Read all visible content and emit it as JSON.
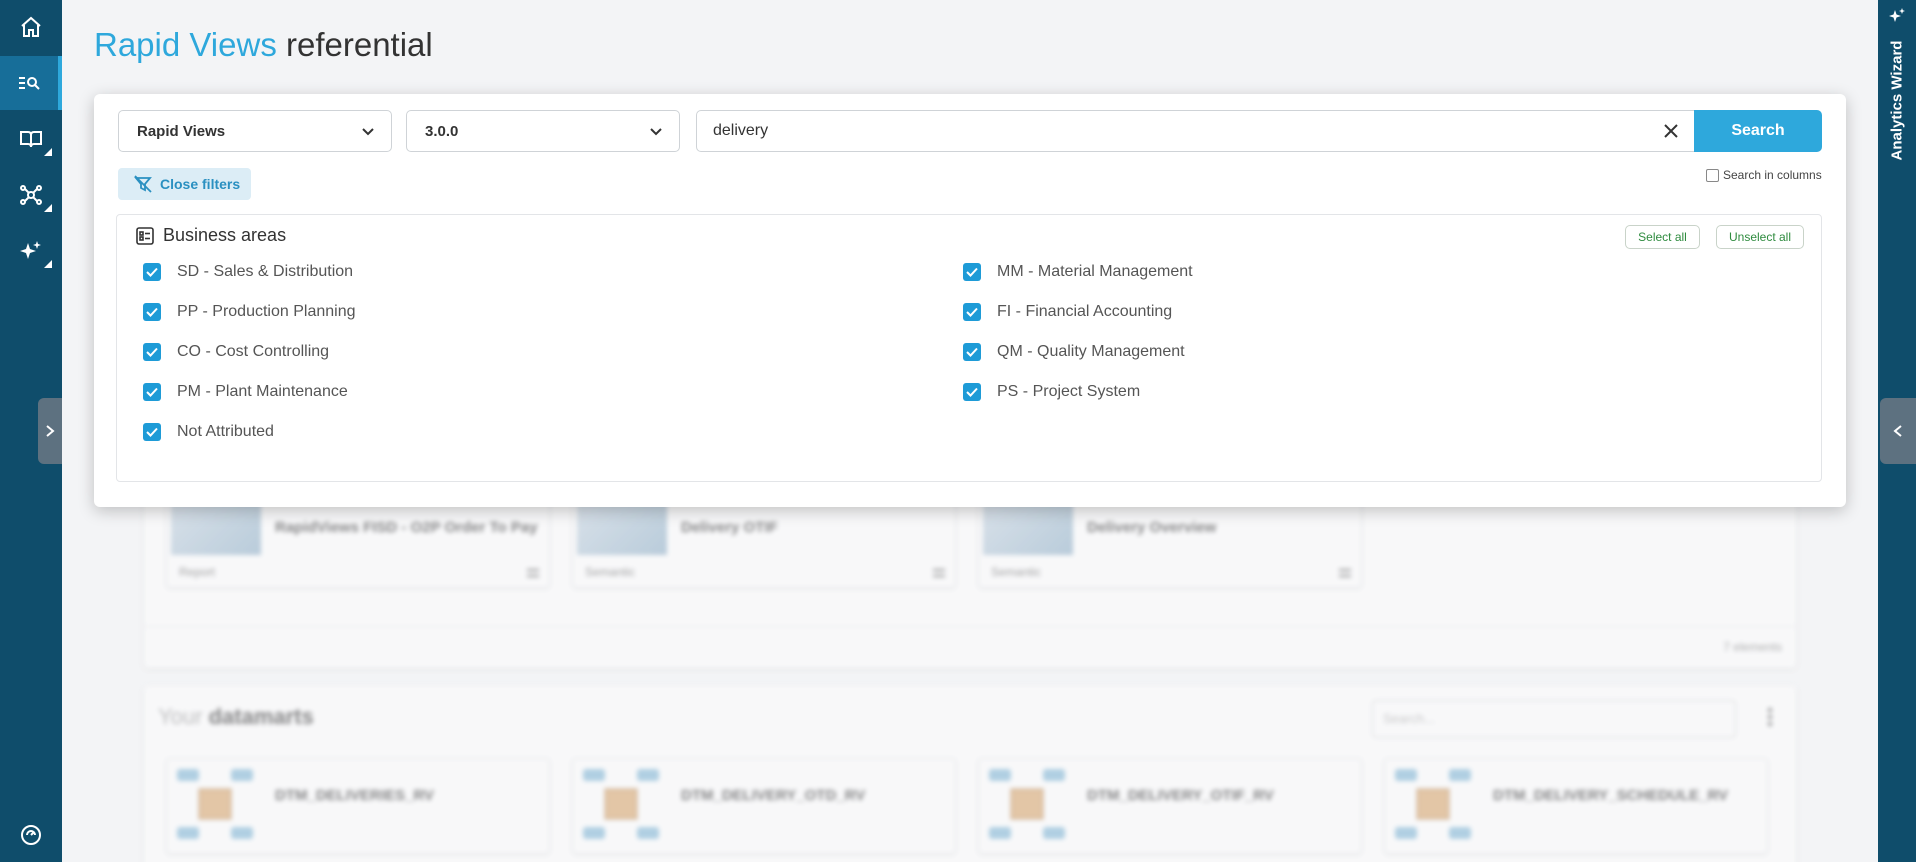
{
  "page": {
    "title_accent": "Rapid Views",
    "title_rest": " referential"
  },
  "nav": {
    "items": [
      "home-icon",
      "search-list-icon",
      "book-icon",
      "network-icon",
      "sparkle-icon"
    ],
    "bottom": "support-icon",
    "active": "search-list-icon"
  },
  "right_rail": {
    "label": "Analytics Wizard"
  },
  "search": {
    "source_select": "Rapid Views",
    "version_select": "3.0.0",
    "query": "delivery",
    "button_label": "Search",
    "close_filters_label": "Close filters",
    "search_in_columns_label": "Search in columns",
    "search_in_columns_checked": false
  },
  "business_areas": {
    "title": "Business areas",
    "select_all_label": "Select all",
    "unselect_all_label": "Unselect all",
    "left": [
      {
        "label": "SD - Sales & Distribution",
        "checked": true
      },
      {
        "label": "PP - Production Planning",
        "checked": true
      },
      {
        "label": "CO - Cost Controlling",
        "checked": true
      },
      {
        "label": "PM - Plant Maintenance",
        "checked": true
      },
      {
        "label": "Not Attributed",
        "checked": true
      }
    ],
    "right": [
      {
        "label": "MM - Material Management",
        "checked": true
      },
      {
        "label": "FI - Financial Accounting",
        "checked": true
      },
      {
        "label": "QM - Quality Management",
        "checked": true
      },
      {
        "label": "PS - Project System",
        "checked": true
      }
    ]
  },
  "background": {
    "report_cards": [
      {
        "title": "RapidViews FISD - O2P Order To Pay",
        "type": "Report"
      },
      {
        "title": "Delivery OTIF",
        "type": "Semantic"
      },
      {
        "title": "Delivery Overview",
        "type": "Semantic"
      }
    ],
    "elements_count": "7 elements",
    "datamarts_prefix": "Your ",
    "datamarts_title": "datamarts",
    "datamart_search_placeholder": "Search...",
    "datamarts": [
      "DTM_DELIVERIES_RV",
      "DTM_DELIVERY_OTD_RV",
      "DTM_DELIVERY_OTIF_RV",
      "DTM_DELIVERY_SCHEDULE_RV"
    ]
  },
  "colors": {
    "nav_bg": "#0f4d6b",
    "accent": "#2ea8dc",
    "checkbox": "#1e9bd7",
    "pill_text": "#2e8b3e"
  }
}
